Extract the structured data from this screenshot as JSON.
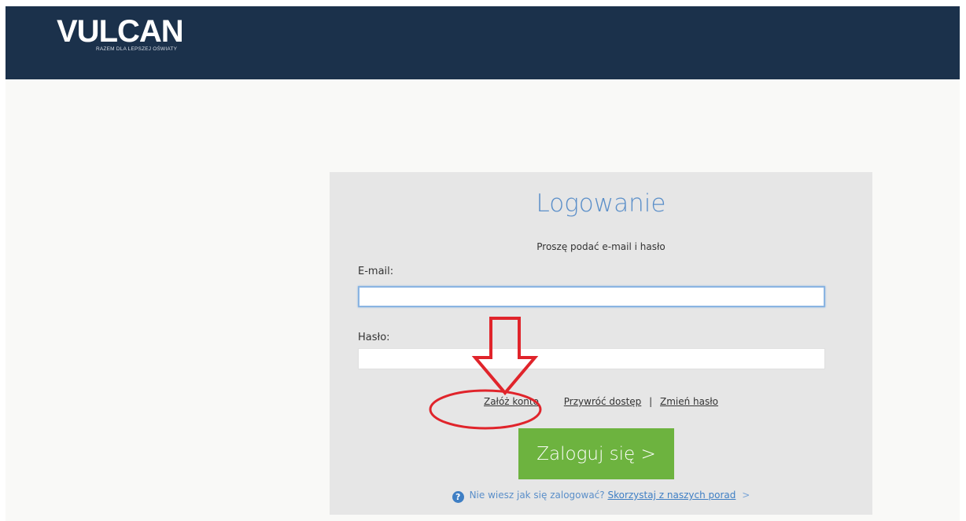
{
  "header": {
    "logo_text": "VULCAN",
    "logo_tagline": "RAZEM DLA LEPSZEJ OŚWIATY"
  },
  "login": {
    "title": "Logowanie",
    "subtitle": "Proszę podać e-mail i hasło",
    "email_label": "E-mail:",
    "email_value": "",
    "password_label": "Hasło:",
    "password_value": "",
    "link_create_account": "Załóż konto",
    "link_restore_access": "Przywróć dostęp",
    "separator": "|",
    "link_change_password": "Zmień hasło",
    "submit_label": "Zaloguj się >",
    "help_icon_glyph": "?",
    "help_text": "Nie wiesz jak się zalogować?",
    "help_link": "Skorzystaj z naszych porad",
    "help_chevron": ">"
  },
  "annotation": {
    "arrow_icon": "arrow-down-outline",
    "circle_icon": "ellipse-highlight",
    "color": "#e0242b"
  },
  "colors": {
    "header_bg": "#1b314b",
    "panel_bg": "#e6e6e6",
    "title_blue": "#5b8fc9",
    "button_green": "#6db33f"
  }
}
